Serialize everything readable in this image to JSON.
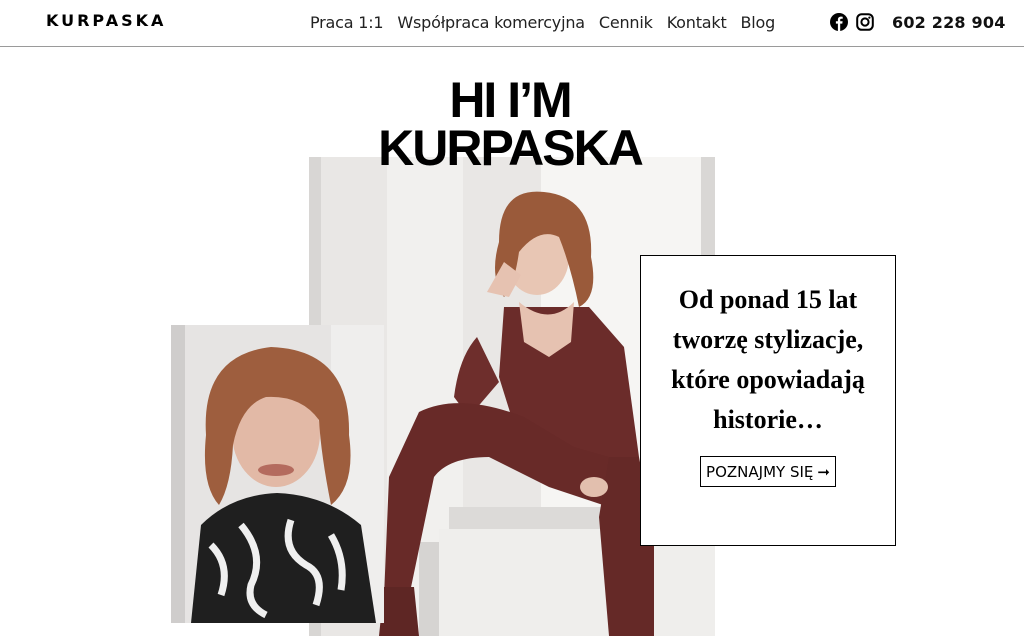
{
  "header": {
    "logo": "KURPASKA",
    "nav": [
      "Praca 1:1",
      "Współpraca komercyjna",
      "Cennik",
      "Kontakt",
      "Blog"
    ],
    "social_icons": [
      "facebook-icon",
      "instagram-icon"
    ],
    "phone": "602 228 904"
  },
  "hero": {
    "title_line1": "HI I’M",
    "title_line2": "KURPASKA",
    "quote": "Od ponad 15 lat tworzę stylizacje, które opowiadają historie…",
    "cta_label": "POZNAJMY SIĘ",
    "cta_arrow": "➞"
  },
  "colors": {
    "suit": "#6e2e2c",
    "hair": "#9a5a3a",
    "background": "#ffffff",
    "border": "#000000"
  }
}
